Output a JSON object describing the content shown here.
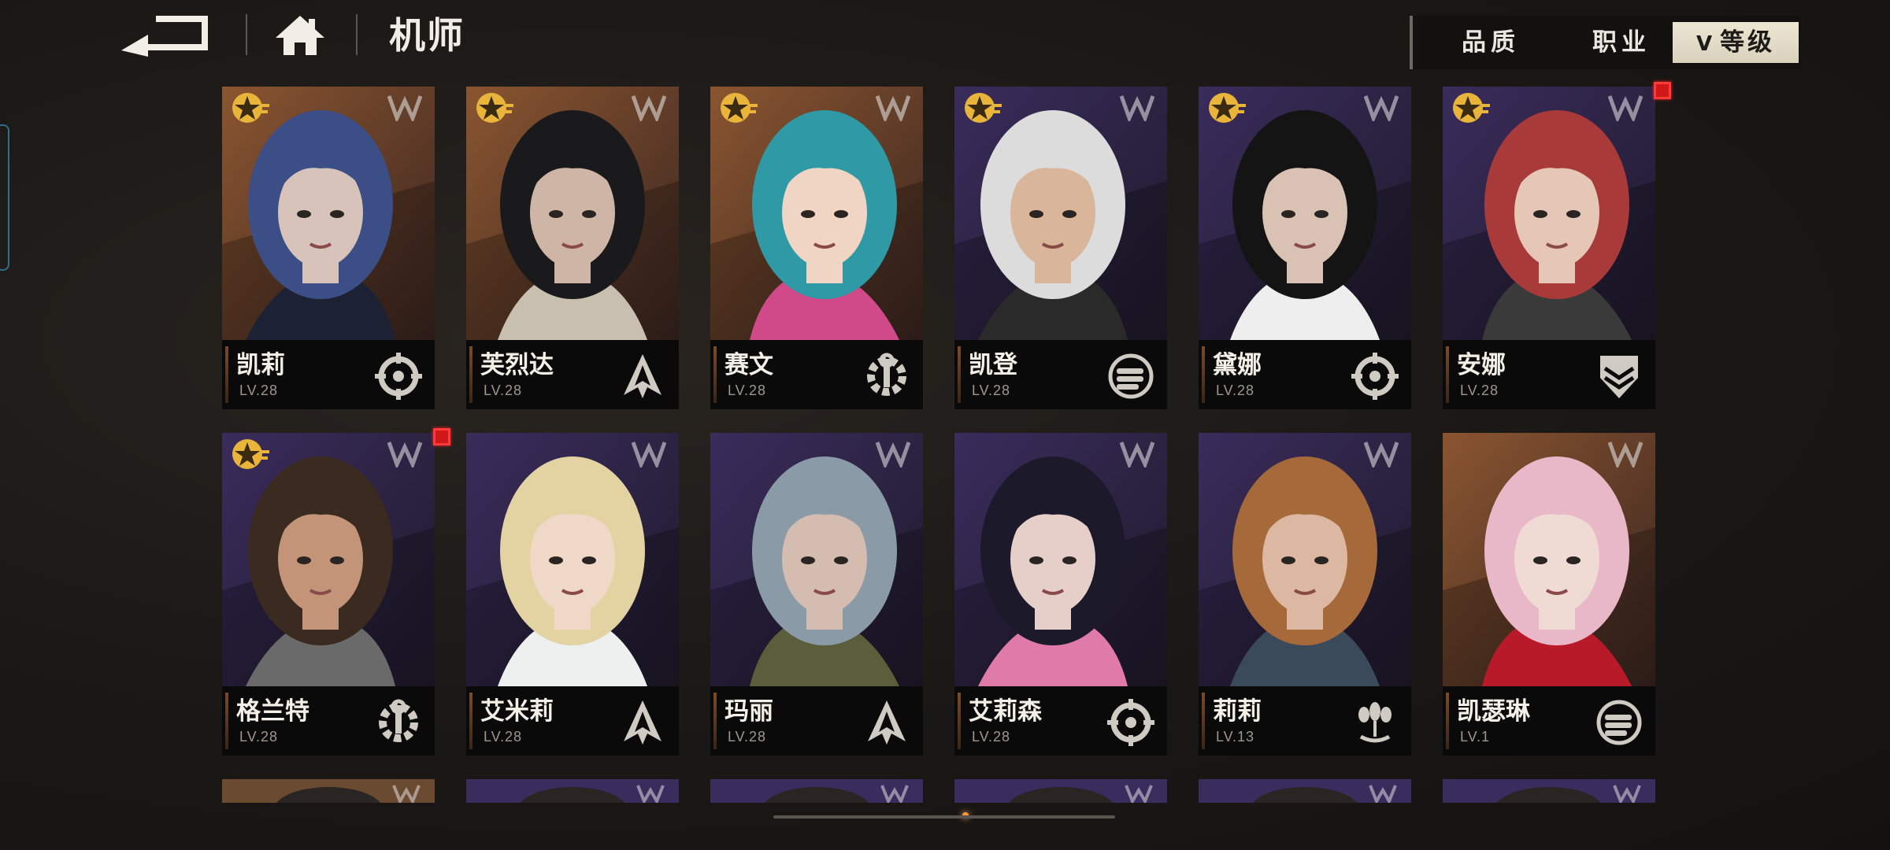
{
  "header": {
    "back_icon": "back-arrow-icon",
    "home_icon": "home-icon",
    "title": "机师"
  },
  "sort": {
    "quality_label": "品质",
    "job_label": "职业",
    "level_label": "等级",
    "level_chevron": "V"
  },
  "colors": {
    "accent_gold": "#e8b53a",
    "new_dot": "#d01818",
    "sort_active_bg": "#e6dfca"
  },
  "cards": [
    {
      "name": "凯莉",
      "level": "LV.28",
      "class_icon": "crosshair-icon",
      "bg": "orange",
      "star": true,
      "new": false
    },
    {
      "name": "芙烈达",
      "level": "LV.28",
      "class_icon": "arrows-icon",
      "bg": "orange",
      "star": true,
      "new": false
    },
    {
      "name": "赛文",
      "level": "LV.28",
      "class_icon": "wrench-gear-icon",
      "bg": "orange",
      "star": true,
      "new": false
    },
    {
      "name": "凯登",
      "level": "LV.28",
      "class_icon": "fist-icon",
      "bg": "purple",
      "star": true,
      "new": false
    },
    {
      "name": "黛娜",
      "level": "LV.28",
      "class_icon": "crosshair-icon",
      "bg": "purple",
      "star": true,
      "new": false
    },
    {
      "name": "安娜",
      "level": "LV.28",
      "class_icon": "shield-chevron-icon",
      "bg": "purple",
      "star": true,
      "new": true
    },
    {
      "name": "格兰特",
      "level": "LV.28",
      "class_icon": "wrench-gear-icon",
      "bg": "purple",
      "star": true,
      "new": true
    },
    {
      "name": "艾米莉",
      "level": "LV.28",
      "class_icon": "arrows-icon",
      "bg": "purple",
      "star": false,
      "new": false
    },
    {
      "name": "玛丽",
      "level": "LV.28",
      "class_icon": "arrows-icon",
      "bg": "purple",
      "star": false,
      "new": false
    },
    {
      "name": "艾莉森",
      "level": "LV.28",
      "class_icon": "crosshair-icon",
      "bg": "purple",
      "star": false,
      "new": false
    },
    {
      "name": "莉莉",
      "level": "LV.13",
      "class_icon": "bombs-icon",
      "bg": "purple",
      "star": false,
      "new": false
    },
    {
      "name": "凯瑟琳",
      "level": "LV.1",
      "class_icon": "fist-icon",
      "bg": "orange",
      "star": false,
      "new": false
    }
  ],
  "portrait_palette": [
    {
      "hair": "#3b4e86",
      "skin": "#d7c3ba",
      "accent": "#1c2233"
    },
    {
      "hair": "#1a1a1c",
      "skin": "#cfb5a6",
      "accent": "#c9bfb0"
    },
    {
      "hair": "#2f9aa5",
      "skin": "#f0d4c4",
      "accent": "#d04a8a"
    },
    {
      "hair": "#dcdcdc",
      "skin": "#d9b59a",
      "accent": "#2a2a2a"
    },
    {
      "hair": "#141414",
      "skin": "#d9c2b4",
      "accent": "#eeeeee"
    },
    {
      "hair": "#a83a3a",
      "skin": "#e6c6b6",
      "accent": "#3a3a3a"
    },
    {
      "hair": "#3a2a20",
      "skin": "#c49478",
      "accent": "#6a6a6a"
    },
    {
      "hair": "#e3d3a3",
      "skin": "#f0d8c8",
      "accent": "#eef0f0"
    },
    {
      "hair": "#8a9aa6",
      "skin": "#d4bcb0",
      "accent": "#5a5e3a"
    },
    {
      "hair": "#1c1a2a",
      "skin": "#e6cfc8",
      "accent": "#e07aa8"
    },
    {
      "hair": "#a66a3a",
      "skin": "#dcb8a2",
      "accent": "#3a4a5a"
    },
    {
      "hair": "#e8b8c8",
      "skin": "#f0dad4",
      "accent": "#b81a2a"
    }
  ]
}
